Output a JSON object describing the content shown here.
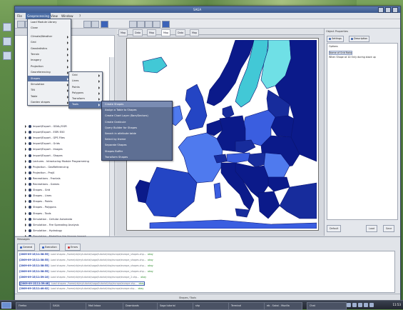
{
  "window": {
    "title": "SAGA"
  },
  "menubar": {
    "items": [
      "File",
      "Geoprocessing",
      "View",
      "Window",
      "?"
    ],
    "active_index": 1
  },
  "left_panel": {
    "tree_items": [
      "Import/Export - GDAL/OGR",
      "Import/Export - ESRI E00",
      "Import/Export - GPS Files",
      "Import/Export - Grids",
      "Import/Export - Images",
      "Import/Export - Shapes",
      "Lectures - Introducing Module Programming",
      "Projection - GeoReferencing",
      "Projection - Proj4",
      "Recreations - Fractals",
      "Recreations - Games",
      "Shapes - Grid",
      "Shapes - Lines",
      "Shapes - Points",
      "Shapes - Polygons",
      "Shapes - Tools",
      "Simulation - Cellular Automata",
      "Simulation - Fire Spreading Analysis",
      "Simulation - Hydrology",
      "Simulation - Modelling the Human Impact",
      "TIN - Tools"
    ]
  },
  "tools_menu": {
    "items": [
      {
        "label": "Load Module Library",
        "sub": false
      },
      {
        "label": "Close",
        "sub": false
      },
      {
        "label": "",
        "sub": false
      },
      {
        "label": "Climate/Weather",
        "sub": true
      },
      {
        "label": "Grid",
        "sub": true
      },
      {
        "label": "Geostatistics",
        "sub": true
      },
      {
        "label": "Terrain",
        "sub": true
      },
      {
        "label": "Imagery",
        "sub": true
      },
      {
        "label": "Projection",
        "sub": true
      },
      {
        "label": "Georeferencing",
        "sub": true
      },
      {
        "label": "Shapes",
        "sub": true
      },
      {
        "label": "Simulation",
        "sub": true
      },
      {
        "label": "TIN",
        "sub": true
      },
      {
        "label": "Table",
        "sub": true
      },
      {
        "label": "Garden shapes",
        "sub": true
      }
    ],
    "selected_index": 10
  },
  "shapes_menu": {
    "items": [
      {
        "label": "Grid",
        "sub": true
      },
      {
        "label": "Lines",
        "sub": true
      },
      {
        "label": "Points",
        "sub": true
      },
      {
        "label": "Polygons",
        "sub": true
      },
      {
        "label": "Transform",
        "sub": true
      },
      {
        "label": "Tools",
        "sub": true
      }
    ],
    "selected_index": 5
  },
  "vector_menu": {
    "items": [
      "Create Shapes",
      "Assign a Table to Shapes",
      "Create Chart Layer (Bars/Sectors)",
      "Create Graticule",
      "Query Builder for Shapes",
      "Search in attribute table",
      "Select by theme",
      "Separate Shapes",
      "Shapes Buffer",
      "Transform Shapes"
    ],
    "selected_index": 0
  },
  "map": {
    "tabs": [
      "Map",
      "Data",
      "Map",
      "Map",
      "Data",
      "Map"
    ],
    "active_tab_index": 3,
    "colors": {
      "ocean": "#ffffff",
      "navy": "#0b1a8a",
      "dark": "#172c9c",
      "medium": "#2445c4",
      "royal": "#3a5ee0",
      "light": "#4f7aee",
      "cyan": "#42c8d6",
      "cyan_light": "#6fe0e6"
    }
  },
  "right_panel": {
    "title": "Object Properties",
    "tabs": [
      "Settings",
      "Description"
    ],
    "rows": [
      "Options",
      "Name of Grid Ratio",
      "When Shape at 10 Only during stack up"
    ],
    "buttons": [
      "Default",
      "Load",
      "Save"
    ]
  },
  "bottom_panel": {
    "title": "Messages",
    "tabs": [
      "General",
      "Execution",
      "Errors"
    ],
    "log": [
      {
        "ts": "[2009-09-15/11:38:55]",
        "text": "Load shapes: /home/cb/mytutorial/saga/tutorial/shp/europe/europe_shapes.shp...",
        "ok": "okay"
      },
      {
        "ts": "[2009-09-15/11:38:55]",
        "text": "Load shapes: /home/cb/mytutorial/saga/tutorial/shp/europe/europe_shapes.shp...",
        "ok": "okay"
      },
      {
        "ts": "[2009-09-15/11:38:55]",
        "text": "Load shapes: /home/cb/mytutorial/saga/tutorial/shp/europe/europe_shapes.shp...",
        "ok": "okay"
      },
      {
        "ts": "[2009-09-15/11:38:55]",
        "text": "Load shapes: /home/cb/mytutorial/saga/tutorial/shp/europe/europe_shapes.shp...",
        "ok": "okay"
      },
      {
        "ts": "[2009-09-15/11:39:10]",
        "text": "Load shapes: /home/cb/mytutorial/saga/tutorial/shp/europe/europe_2.shp...",
        "ok": "okay"
      },
      {
        "ts": "[2009-09-15/11:39:48]",
        "text": "Load shapes: /home/cb/mytutorial/saga/tutorial/shp/europe/europe.shp...",
        "ok": "okay"
      },
      {
        "ts": "[2009-09-15/11:40:02]",
        "text": "Load shapes: /home/cb/mytutorial/saga/tutorial/shp/europe/europe.shp...",
        "ok": "okay"
      }
    ]
  },
  "status": {
    "text": "Shapes / Tools"
  },
  "taskbar": {
    "tasks": [
      "Firefox",
      "SAGA",
      "Mail Inbox",
      "Downloads",
      "Saga tutorial",
      "shp",
      "Terminal",
      "eb - Sakai - Mozilla",
      "Chat"
    ],
    "clock": "11:53"
  }
}
